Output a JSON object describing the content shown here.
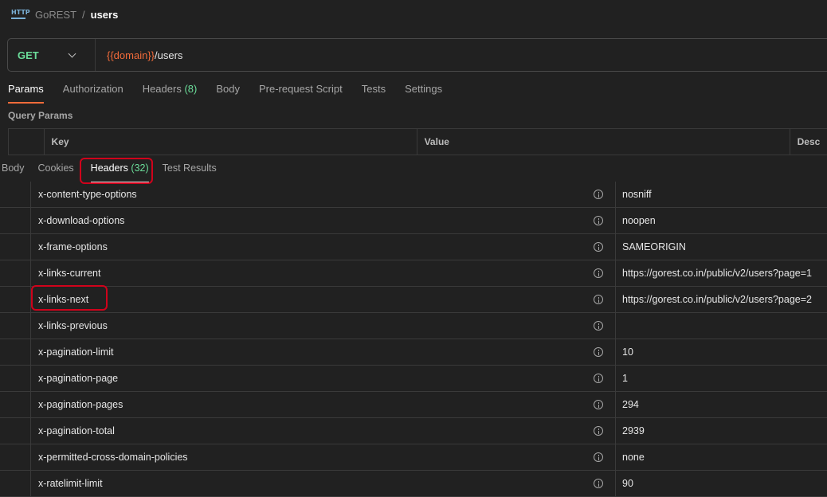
{
  "breadcrumb": {
    "icon": "http-icon",
    "icon_text": "HTTP",
    "parent": "GoREST",
    "separator": "/",
    "current": "users"
  },
  "request": {
    "method": "GET",
    "url_variable": "{{domain}}",
    "url_path": "/users"
  },
  "request_tabs": [
    {
      "label": "Params",
      "active": true
    },
    {
      "label": "Authorization"
    },
    {
      "label": "Headers",
      "count": "(8)"
    },
    {
      "label": "Body"
    },
    {
      "label": "Pre-request Script"
    },
    {
      "label": "Tests"
    },
    {
      "label": "Settings"
    }
  ],
  "query_params": {
    "title": "Query Params",
    "columns": [
      "Key",
      "Value",
      "Desc"
    ]
  },
  "response_tabs": [
    {
      "label": "Body"
    },
    {
      "label": "Cookies"
    },
    {
      "label": "Headers",
      "count": "(32)",
      "active": true
    },
    {
      "label": "Test Results"
    }
  ],
  "headers": [
    {
      "key": "x-content-type-options",
      "value": "nosniff"
    },
    {
      "key": "x-download-options",
      "value": "noopen"
    },
    {
      "key": "x-frame-options",
      "value": "SAMEORIGIN"
    },
    {
      "key": "x-links-current",
      "value": "https://gorest.co.in/public/v2/users?page=1"
    },
    {
      "key": "x-links-next",
      "value": "https://gorest.co.in/public/v2/users?page=2"
    },
    {
      "key": "x-links-previous",
      "value": ""
    },
    {
      "key": "x-pagination-limit",
      "value": "10"
    },
    {
      "key": "x-pagination-page",
      "value": "1"
    },
    {
      "key": "x-pagination-pages",
      "value": "294"
    },
    {
      "key": "x-pagination-total",
      "value": "2939"
    },
    {
      "key": "x-permitted-cross-domain-policies",
      "value": "none"
    },
    {
      "key": "x-ratelimit-limit",
      "value": "90"
    }
  ],
  "colors": {
    "accent": "#f26b3a",
    "method": "#6bdd9a",
    "highlight": "#d0021b",
    "background": "#212121"
  }
}
